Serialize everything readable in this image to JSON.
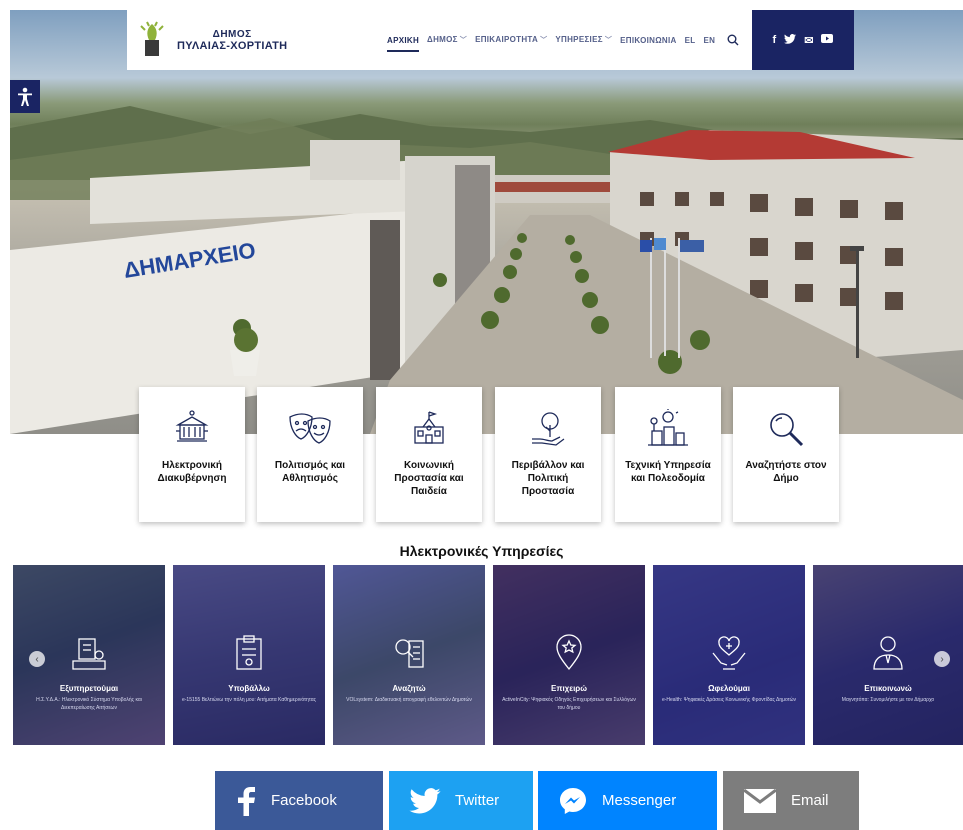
{
  "header": {
    "logo_line1": "ΔΗΜΟΣ",
    "logo_line2": "ΠΥΛΑΙΑΣ-ΧΟΡΤΙΑΤΗ",
    "nav": [
      {
        "label": "ΑΡΧΙΚΗ",
        "dropdown": false,
        "active": true
      },
      {
        "label": "ΔΗΜΟΣ",
        "dropdown": true,
        "active": false
      },
      {
        "label": "ΕΠΙΚΑΙΡΟΤΗΤΑ",
        "dropdown": true,
        "active": false
      },
      {
        "label": "ΥΠΗΡΕΣΙΕΣ",
        "dropdown": true,
        "active": false
      },
      {
        "label": "ΕΠΙΚΟΙΝΩΝΙΑ",
        "dropdown": false,
        "active": false
      },
      {
        "label": "EL",
        "dropdown": false,
        "active": false
      },
      {
        "label": "EN",
        "dropdown": false,
        "active": false
      }
    ],
    "social": [
      "facebook-icon",
      "twitter-icon",
      "email-icon",
      "youtube-icon"
    ],
    "social_glyphs": {
      "facebook": "f",
      "twitter": "🐦",
      "email": "✉",
      "youtube": "▶"
    }
  },
  "hero": {
    "building_sign": "ΔΗΜΑΡΧΕΙΟ"
  },
  "categories": [
    {
      "label": "Ηλεκτρονική Διακυβέρνηση",
      "icon": "e-government-icon"
    },
    {
      "label": "Πολιτισμός και Αθλητισμός",
      "icon": "theatre-masks-icon"
    },
    {
      "label": "Κοινωνική Προστασία και Παιδεία",
      "icon": "school-building-icon"
    },
    {
      "label": "Περιβάλλον και Πολιτική Προστασία",
      "icon": "plant-hand-icon"
    },
    {
      "label": "Τεχνική Υπηρεσία και Πολεοδομία",
      "icon": "city-planning-icon"
    },
    {
      "label": "Αναζητήστε στον Δήμο",
      "icon": "magnifier-icon"
    }
  ],
  "services": {
    "title": "Ηλεκτρονικές Υπηρεσίες",
    "slides": [
      {
        "title": "Εξυπηρετούμαι",
        "desc": "Η.Σ.Υ.Δ.Α.: Ηλεκτρονικό Σύστημα Υποβολής και Διεκπεραίωσης Αιτήσεων"
      },
      {
        "title": "Υποβάλλω",
        "desc": "e-15155 Βελτιώνω την πόλη μου: Αιτήματα Καθημερινότητας"
      },
      {
        "title": "Αναζητώ",
        "desc": "VOLsystem: Διαδικτυακή απογραφή εθελοντών Δημοτών"
      },
      {
        "title": "Επιχειρώ",
        "desc": "ActiveInCity: Ψηφιακός Οδηγός Επιχειρήσεων και Συλλόγων του δήμου"
      },
      {
        "title": "Ωφελούμαι",
        "desc": "e-Health: Ψηφιακές Δράσεις Κοινωνικής Φροντίδας Δημοτών"
      },
      {
        "title": "Επικοινωνώ",
        "desc": "Μαγνητόπα: Συνομιλήστε με τον Δήμαρχο"
      }
    ],
    "prev": "‹",
    "next": "›"
  },
  "share": [
    {
      "label": "Facebook",
      "color": "#3b5998"
    },
    {
      "label": "Twitter",
      "color": "#1da1f2"
    },
    {
      "label": "Messenger",
      "color": "#0084ff"
    },
    {
      "label": "Email",
      "color": "#7d7d7d"
    }
  ]
}
